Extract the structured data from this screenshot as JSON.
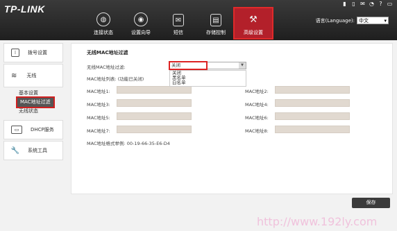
{
  "brand": "TP-LINK",
  "nav": [
    {
      "label": "连接状态",
      "icon": "globe-icon"
    },
    {
      "label": "设置向导",
      "icon": "wizard-icon"
    },
    {
      "label": "短信",
      "icon": "mail-icon"
    },
    {
      "label": "存储控制",
      "icon": "storage-icon"
    },
    {
      "label": "高级设置",
      "icon": "tools-icon"
    }
  ],
  "language": {
    "label": "语言(Language):",
    "value": "中文"
  },
  "sidebar": {
    "dial": "拨号设置",
    "wireless": "无线",
    "sub": [
      "基本设置",
      "MAC地址过滤",
      "无线状态"
    ],
    "dhcp": "DHCP服务",
    "tools": "系统工具"
  },
  "main": {
    "title": "无线MAC地址过滤",
    "filter_label": "无线MAC地址过滤:",
    "filter_value": "关闭",
    "options": [
      "关闭",
      "黑名单",
      "白名单"
    ],
    "list_label": "MAC地址列表: (功能已关闭)",
    "mac_labels": [
      "MAC地址1:",
      "MAC地址2:",
      "MAC地址3:",
      "MAC地址4:",
      "MAC地址5:",
      "MAC地址6:",
      "MAC地址7:",
      "MAC地址8:"
    ],
    "example": "MAC地址格式举例: 00-19-66-35-E6-D4"
  },
  "save": "保存",
  "watermark": "http://www.192ly.com"
}
